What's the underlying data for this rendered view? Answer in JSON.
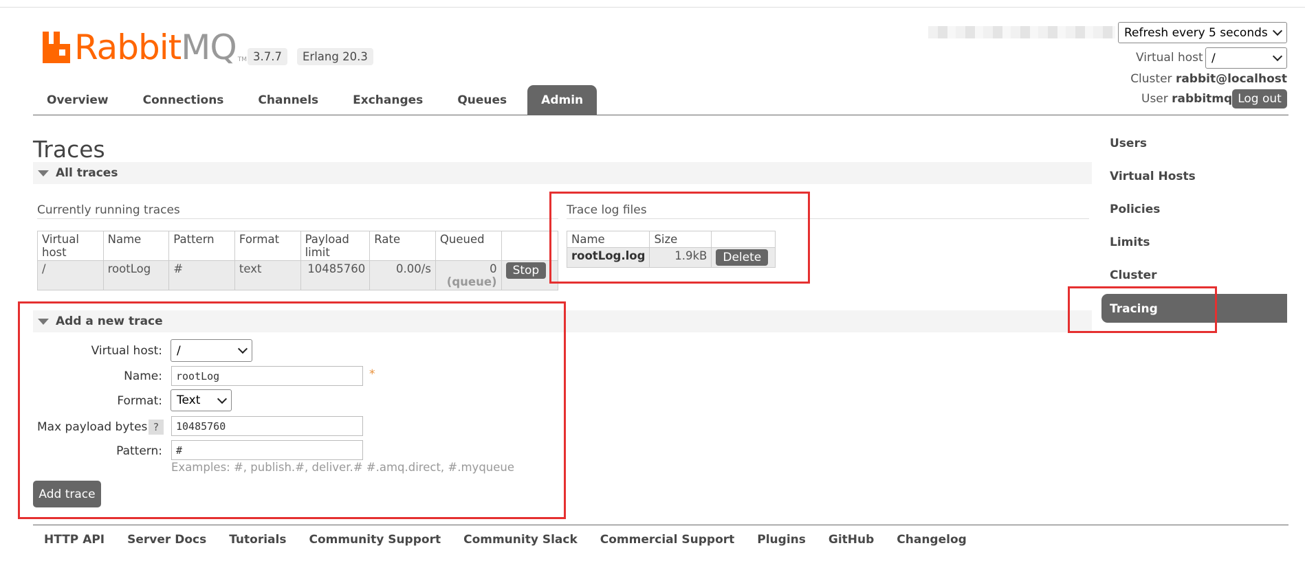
{
  "app": {
    "logo_text": "RabbitMQ",
    "logo_tm": "TM",
    "version": "3.7.7",
    "erlang": "Erlang 20.3"
  },
  "header": {
    "refresh_select": "Refresh every 5 seconds",
    "vhost_label": "Virtual host",
    "vhost_value": "/",
    "cluster_label": "Cluster",
    "cluster_value": "rabbit@localhost",
    "user_label": "User",
    "user_value": "rabbitmq",
    "logout": "Log out"
  },
  "nav": {
    "tabs": [
      "Overview",
      "Connections",
      "Channels",
      "Exchanges",
      "Queues",
      "Admin"
    ],
    "active": "Admin"
  },
  "page": {
    "title": "Traces",
    "all_traces": "All traces",
    "running_title": "Currently running traces",
    "running_table": {
      "headers": [
        "Virtual host",
        "Name",
        "Pattern",
        "Format",
        "Payload limit",
        "Rate",
        "Queued",
        ""
      ],
      "rows": [
        {
          "vhost": "/",
          "name": "rootLog",
          "pattern": "#",
          "format": "text",
          "payload_limit": "10485760",
          "rate": "0.00/s",
          "queued": "0",
          "queued_sub": "(queue)",
          "action": "Stop"
        }
      ]
    },
    "logs_title": "Trace log files",
    "logs_table": {
      "headers": [
        "Name",
        "Size",
        ""
      ],
      "rows": [
        {
          "name": "rootLog.log",
          "size": "1.9kB",
          "action": "Delete"
        }
      ]
    },
    "add_section": "Add a new trace",
    "form": {
      "vhost_label": "Virtual host:",
      "vhost_value": "/",
      "name_label": "Name:",
      "name_value": "rootLog",
      "required": "*",
      "format_label": "Format:",
      "format_value": "Text",
      "max_payload_label": "Max payload bytes:",
      "help": "?",
      "max_payload_value": "10485760",
      "pattern_label": "Pattern:",
      "pattern_value": "#",
      "examples": "Examples: #, publish.#, deliver.# #.amq.direct, #.myqueue",
      "submit": "Add trace"
    }
  },
  "sidebar": {
    "items": [
      "Users",
      "Virtual Hosts",
      "Policies",
      "Limits",
      "Cluster",
      "Tracing"
    ],
    "active": "Tracing"
  },
  "footer": {
    "links": [
      "HTTP API",
      "Server Docs",
      "Tutorials",
      "Community Support",
      "Community Slack",
      "Commercial Support",
      "Plugins",
      "GitHub",
      "Changelog"
    ]
  },
  "colors": {
    "brand": "#ff6600",
    "active_tab": "#666666",
    "highlight": "#e53030"
  }
}
